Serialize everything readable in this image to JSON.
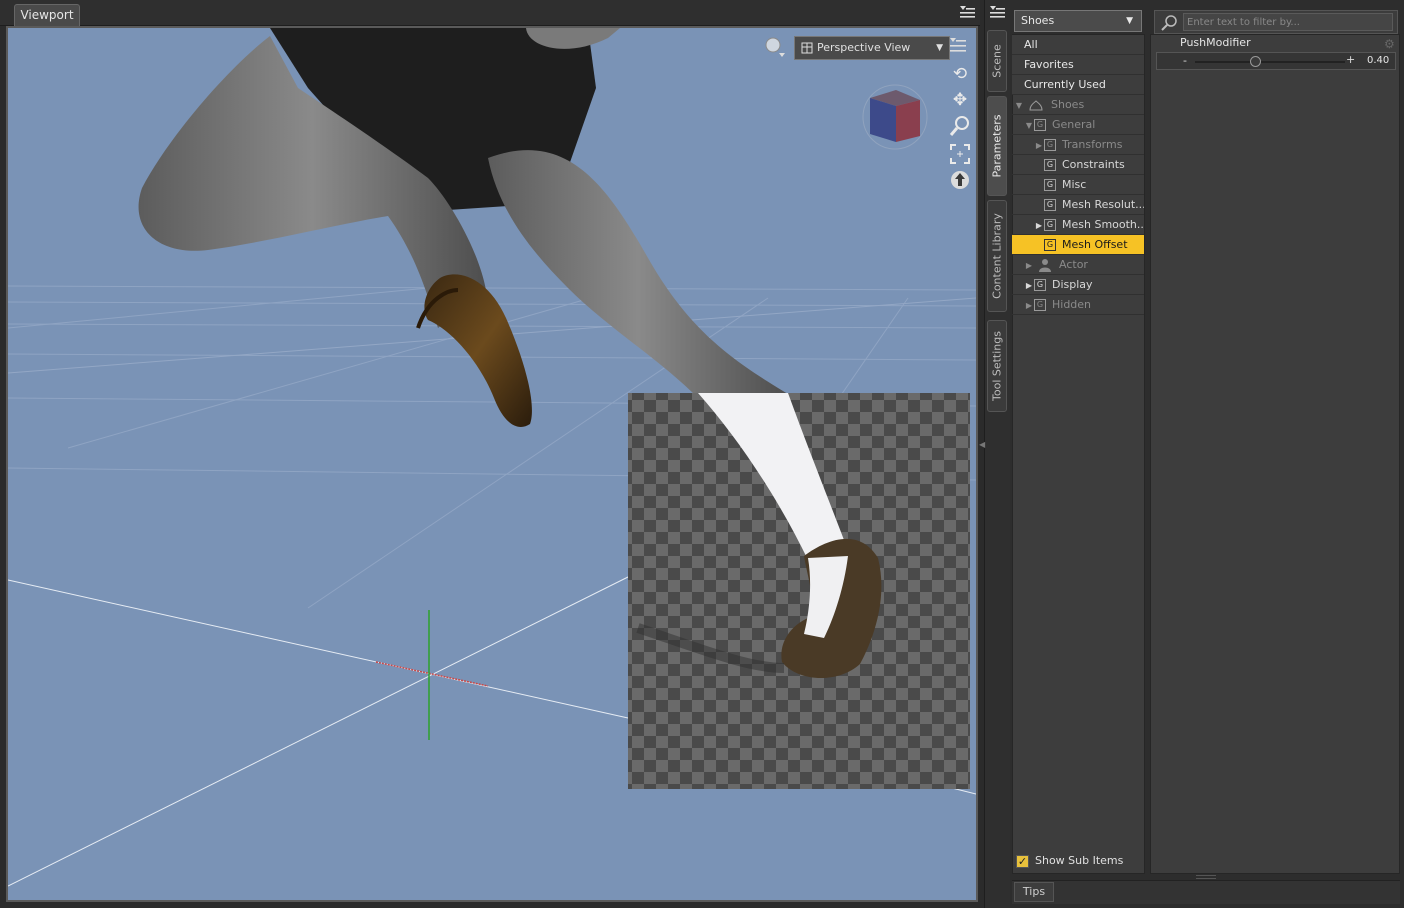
{
  "viewport": {
    "tab_label": "Viewport",
    "view_dropdown": "Perspective View",
    "tools": [
      "orbit-icon",
      "pan-icon",
      "zoom-icon",
      "frame-icon",
      "reset-icon"
    ]
  },
  "side_tabs": [
    "Scene",
    "Parameters",
    "Content Library",
    "Tool Settings"
  ],
  "parameters": {
    "node_selector": "Shoes",
    "filter_placeholder": "Enter text to filter by...",
    "tree": [
      {
        "label": "All",
        "kind": "header"
      },
      {
        "label": "Favorites",
        "kind": "header"
      },
      {
        "label": "Currently Used",
        "kind": "header"
      },
      {
        "label": "Shoes",
        "kind": "node",
        "expanded": true,
        "dim": true
      },
      {
        "label": "General",
        "kind": "group",
        "expanded": true,
        "dim": true
      },
      {
        "label": "Transforms",
        "kind": "group",
        "collapsed": true,
        "dim": true
      },
      {
        "label": "Constraints",
        "kind": "group"
      },
      {
        "label": "Misc",
        "kind": "group"
      },
      {
        "label": "Mesh Resolut...",
        "kind": "group"
      },
      {
        "label": "Mesh Smooth...",
        "kind": "group",
        "collapsed": true
      },
      {
        "label": "Mesh Offset",
        "kind": "group",
        "selected": true
      },
      {
        "label": "Actor",
        "kind": "actor",
        "collapsed": true,
        "dim": true
      },
      {
        "label": "Display",
        "kind": "group",
        "collapsed": true
      },
      {
        "label": "Hidden",
        "kind": "group",
        "collapsed": true,
        "dim": true
      }
    ],
    "show_sub_items_label": "Show Sub Items",
    "show_sub_items_checked": true,
    "property": {
      "name": "PushModifier",
      "value": "0.40",
      "minus": "-",
      "plus": "+",
      "fraction": 0.4
    },
    "tips_label": "Tips"
  },
  "colors": {
    "selection": "#f6c225",
    "viewport_bg": "#7a93b6"
  }
}
